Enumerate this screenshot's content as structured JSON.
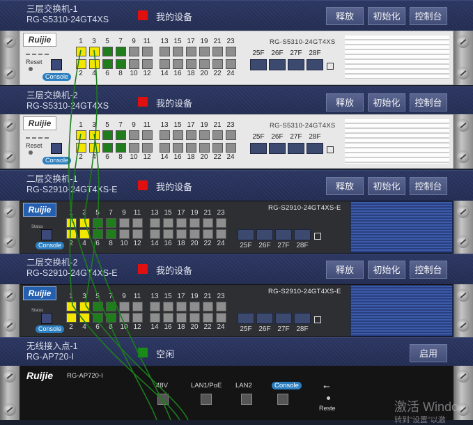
{
  "devices": [
    {
      "name": "三层交换机-1",
      "model": "RG-S5310-24GT4XS",
      "status": "我的设备",
      "status_color": "#e01010",
      "buttons": [
        "释放",
        "初始化",
        "控制台"
      ]
    },
    {
      "name": "三层交换机-2",
      "model": "RG-S5310-24GT4XS",
      "status": "我的设备",
      "status_color": "#e01010",
      "buttons": [
        "释放",
        "初始化",
        "控制台"
      ]
    },
    {
      "name": "二层交换机-1",
      "model": "RG-S2910-24GT4XS-E",
      "status": "我的设备",
      "status_color": "#e01010",
      "buttons": [
        "释放",
        "初始化",
        "控制台"
      ]
    },
    {
      "name": "二层交换机-2",
      "model": "RG-S2910-24GT4XS-E",
      "status": "我的设备",
      "status_color": "#e01010",
      "buttons": [
        "释放",
        "初始化",
        "控制台"
      ]
    },
    {
      "name": "无线接入点-1",
      "model": "RG-AP720-I",
      "status": "空闲",
      "status_color": "#1a8a1a",
      "buttons": [
        "启用"
      ]
    }
  ],
  "switch_panels": [
    {
      "logo": "Ruijie",
      "model_label": "RG-S5310-24GT4XS",
      "reset": "Reset",
      "console": "Console"
    },
    {
      "logo": "Ruijie",
      "model_label": "RG-S5310-24GT4XS",
      "reset": "Reset",
      "console": "Console"
    },
    {
      "logo": "Ruijie",
      "model_label": "RG-S2910-24GT4XS-E",
      "status": "Status",
      "console": "Console"
    },
    {
      "logo": "Ruijie",
      "model_label": "RG-S2910-24GT4XS-E",
      "status": "Status",
      "console": "Console"
    }
  ],
  "port_labels_top": [
    "1",
    "3",
    "5",
    "7",
    "9",
    "11",
    "13",
    "15",
    "17",
    "19",
    "21",
    "23"
  ],
  "port_labels_bottom": [
    "2",
    "4",
    "6",
    "8",
    "10",
    "12",
    "14",
    "16",
    "18",
    "20",
    "22",
    "24"
  ],
  "sfp_labels": [
    "25F",
    "26F",
    "27F",
    "28F"
  ],
  "ap_panel": {
    "logo": "Ruijie",
    "model_label": "RG-AP720-I",
    "power": "48V",
    "lan1": "LAN1/PoE",
    "lan2": "LAN2",
    "console": "Console",
    "reset": "Reste"
  },
  "watermark": {
    "line1": "激活 Windo",
    "line2": "转到\"设置\"以激"
  },
  "colors": {
    "header_bg": "#262f58",
    "active_port": "#f2e600",
    "link_port": "#1f7d1c",
    "idle_port": "#8e8e8e",
    "cable": "#1d7d1d"
  }
}
